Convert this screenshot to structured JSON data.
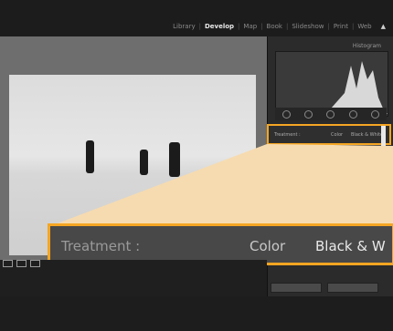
{
  "modules": {
    "items": [
      "Library",
      "Develop",
      "Map",
      "Book",
      "Slideshow",
      "Print",
      "Web"
    ],
    "active": "Develop"
  },
  "panel": {
    "histogram_title": "Histogram",
    "treatment_label": "Treatment :",
    "treatment_options": [
      "Color",
      "Black & White"
    ],
    "selected": "Black & White"
  },
  "callout": {
    "label": "Treatment :",
    "option_color": "Color",
    "option_bw": "Black & W"
  },
  "colors": {
    "accent": "#f5a623",
    "panel_bg": "#2b2b2b",
    "callout_fill": "#f6dbb0"
  }
}
